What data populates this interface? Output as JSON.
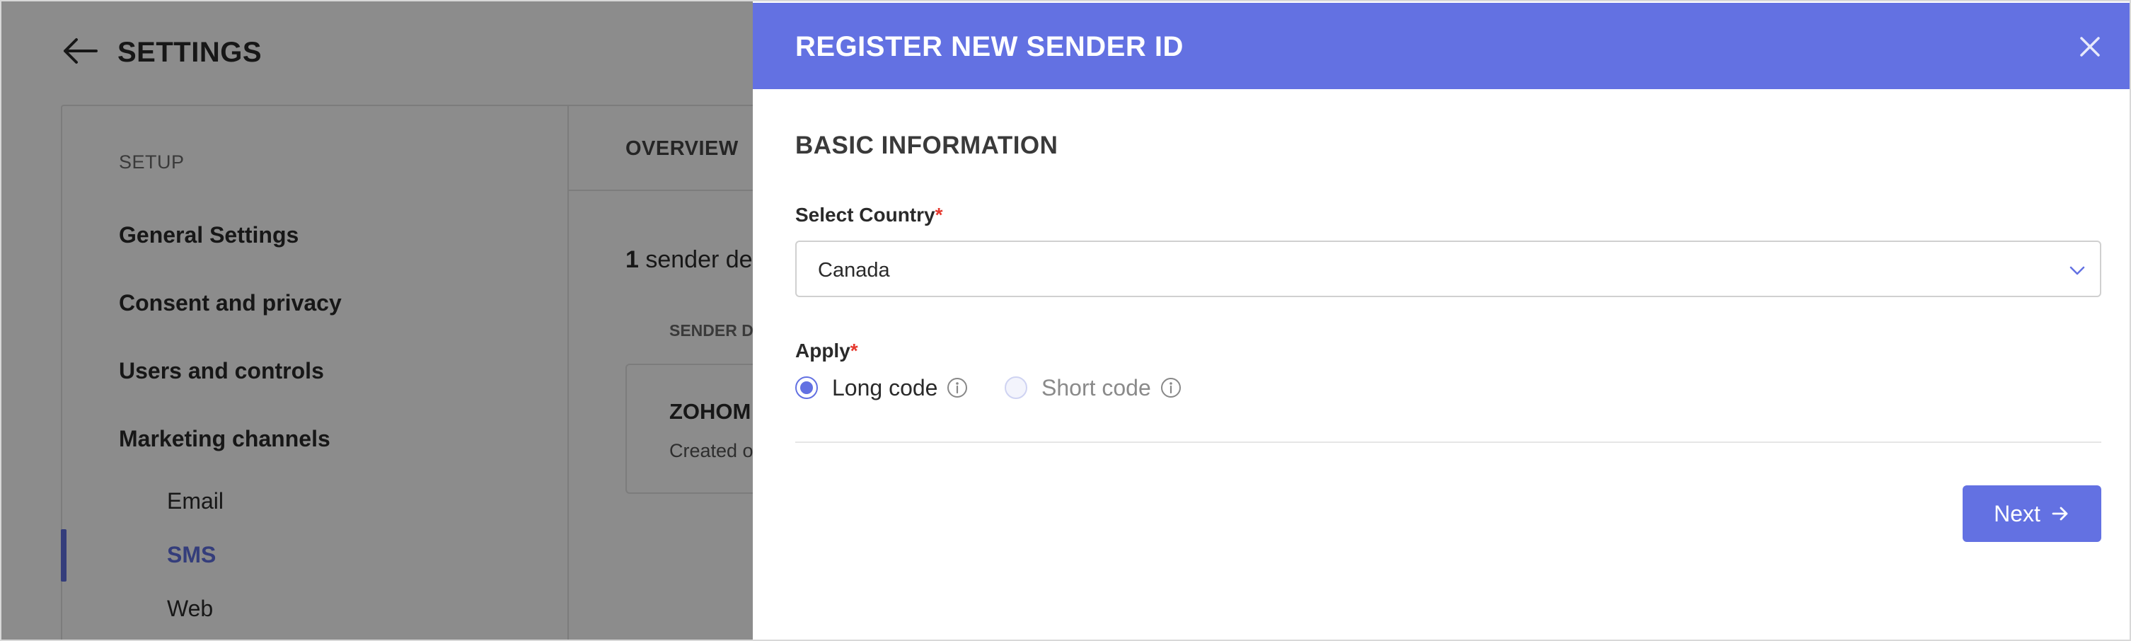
{
  "settings_page": {
    "title": "SETTINGS",
    "sidebar": {
      "section_label": "SETUP",
      "items": [
        {
          "label": "General Settings"
        },
        {
          "label": "Consent and privacy"
        },
        {
          "label": "Users and controls"
        },
        {
          "label": "Marketing channels"
        }
      ],
      "sub_items": [
        {
          "label": "Email",
          "active": false
        },
        {
          "label": "SMS",
          "active": true
        },
        {
          "label": "Web",
          "active": false
        }
      ]
    },
    "content": {
      "tab_label": "OVERVIEW",
      "sender_count": "1",
      "sender_count_suffix": " sender de",
      "column_header": "SENDER DE",
      "sender_card": {
        "name": "ZOHOM",
        "meta": "Created o"
      }
    }
  },
  "modal": {
    "title": "REGISTER NEW SENDER ID",
    "section_title": "BASIC INFORMATION",
    "country": {
      "label": "Select Country",
      "required_mark": "*",
      "value": "Canada"
    },
    "apply": {
      "label": "Apply",
      "required_mark": "*",
      "options": [
        {
          "label": "Long code",
          "selected": true,
          "disabled": false
        },
        {
          "label": "Short code",
          "selected": false,
          "disabled": true
        }
      ]
    },
    "next_label": "Next"
  },
  "colors": {
    "accent": "#6371e2",
    "required": "#e5392f",
    "overlay": "rgba(0,0,0,0.45)"
  },
  "icons": {
    "back": "back-arrow-icon",
    "close": "close-icon",
    "dropdown": "chevron-down-icon",
    "info": "info-icon",
    "next": "arrow-right-icon"
  }
}
